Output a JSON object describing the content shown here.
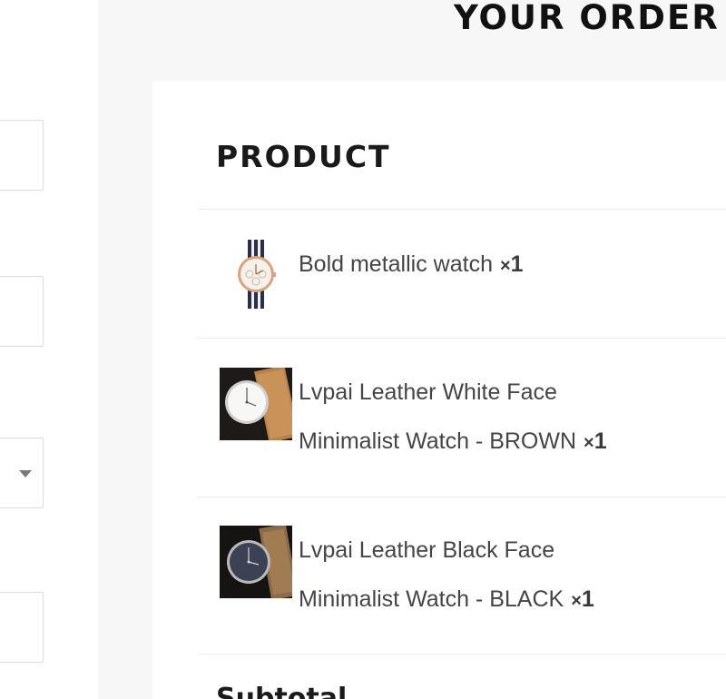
{
  "order": {
    "heading": "YOUR ORDER",
    "product_header": "PRODUCT",
    "items": [
      {
        "name": "Bold metallic watch",
        "qty_symbol": "×",
        "qty": "1"
      },
      {
        "name": "Lvpai Leather White Face Minimalist Watch - BROWN",
        "qty_symbol": "×",
        "qty": "1"
      },
      {
        "name": "Lvpai Leather Black Face Minimalist Watch - BLACK",
        "qty_symbol": "×",
        "qty": "1"
      }
    ],
    "subtotal_label": "Subtotal"
  },
  "billing_form": {
    "fields": [
      {
        "type": "text-input"
      },
      {
        "type": "text-input"
      },
      {
        "type": "select",
        "icon": "caret-down-icon"
      },
      {
        "type": "text-input"
      }
    ]
  },
  "colors": {
    "panel_background": "#f7f7f7",
    "card_background": "#ffffff",
    "heading_text": "#111111",
    "body_text": "#454545",
    "divider": "#ececec",
    "field_border": "#dddddd"
  }
}
